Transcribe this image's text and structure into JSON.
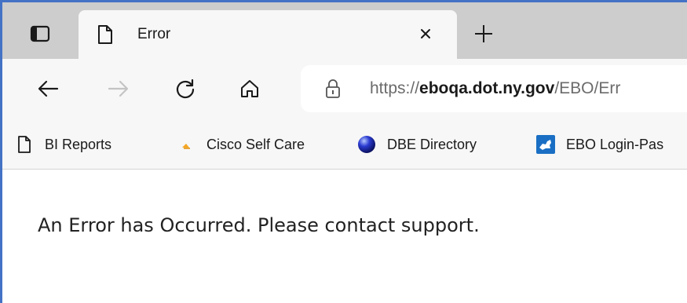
{
  "tab": {
    "title": "Error"
  },
  "icons": {
    "tab_actions": "tab-actions-icon",
    "favicon": "page-icon",
    "close": "close-icon",
    "new_tab": "plus-icon",
    "back": "back-arrow-icon",
    "forward": "forward-arrow-icon",
    "refresh": "refresh-icon",
    "home": "home-icon",
    "lock": "lock-icon"
  },
  "address_bar": {
    "prefix": "https://",
    "domain": "eboqa.dot.ny.gov",
    "path": "/EBO/Err"
  },
  "favorites": [
    {
      "label": "BI Reports",
      "icon": "page-icon"
    },
    {
      "label": "Cisco Self Care",
      "icon": "cisco-icon"
    },
    {
      "label": "DBE Directory",
      "icon": "globe-icon"
    },
    {
      "label": "EBO Login-Pas",
      "icon": "ny-state-icon"
    }
  ],
  "page": {
    "message": "An Error has Occurred. Please contact support."
  },
  "colors": {
    "frame_border": "#4472c4",
    "tabstrip_bg": "#cdcdcd",
    "toolbar_bg": "#f7f7f7",
    "cisco_orange": "#f5a623",
    "ny_blue": "#1a6fc4"
  }
}
